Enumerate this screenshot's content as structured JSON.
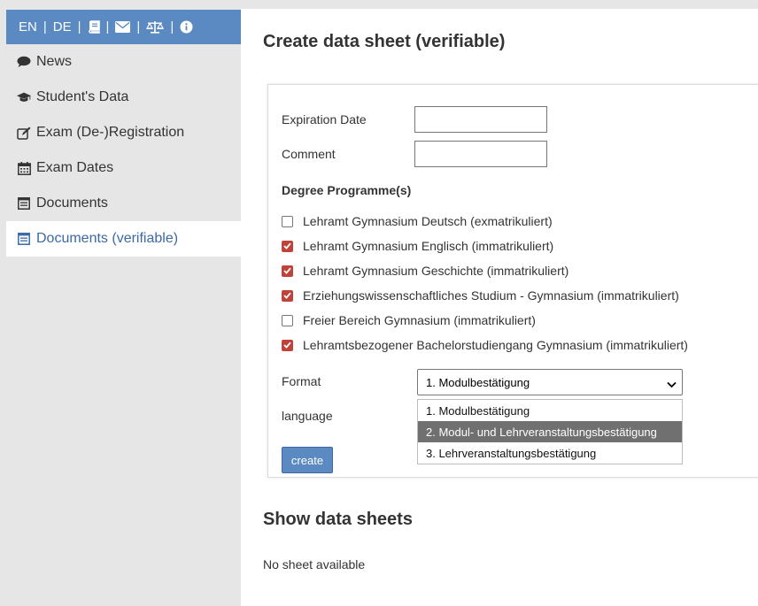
{
  "topbar": {
    "lang_en": "EN",
    "lang_de": "DE",
    "icons": [
      "book-icon",
      "envelope-icon",
      "scale-icon",
      "info-icon"
    ]
  },
  "sidebar": {
    "items": [
      {
        "label": "News",
        "icon": "comment-icon"
      },
      {
        "label": "Student's Data",
        "icon": "graduation-cap-icon"
      },
      {
        "label": "Exam (De-)Registration",
        "icon": "edit-icon"
      },
      {
        "label": "Exam Dates",
        "icon": "calendar-icon"
      },
      {
        "label": "Documents",
        "icon": "document-icon"
      },
      {
        "label": "Documents (verifiable)",
        "icon": "document-icon",
        "active": true
      }
    ]
  },
  "main": {
    "title": "Create data sheet (verifiable)",
    "form": {
      "expiration_label": "Expiration Date",
      "expiration_value": "",
      "comment_label": "Comment",
      "comment_value": "",
      "degree_heading": "Degree Programme(s)",
      "programmes": [
        {
          "label": "Lehramt Gymnasium Deutsch (exmatrikuliert)",
          "checked": false
        },
        {
          "label": "Lehramt Gymnasium Englisch (immatrikuliert)",
          "checked": true
        },
        {
          "label": "Lehramt Gymnasium Geschichte (immatrikuliert)",
          "checked": true
        },
        {
          "label": "Erziehungswissenschaftliches Studium - Gymnasium (immatrikuliert)",
          "checked": true
        },
        {
          "label": "Freier Bereich Gymnasium (immatrikuliert)",
          "checked": false
        },
        {
          "label": "Lehramtsbezogener Bachelorstudiengang Gymnasium (immatrikuliert)",
          "checked": true
        }
      ],
      "format_label": "Format",
      "format_selected": "1. Modulbestätigung",
      "format_options": [
        "1. Modulbestätigung",
        "2. Modul- und Lehrveranstaltungsbestätigung",
        "3. Lehrveranstaltungsbestätigung"
      ],
      "highlighted_option_index": 1,
      "language_label": "language",
      "create_label": "create"
    },
    "sheets_title": "Show data sheets",
    "no_sheet_text": "No sheet available"
  },
  "colors": {
    "sidebar_bg": "#e6e6e6",
    "accent": "#5b89c1",
    "active_text": "#3a69a6",
    "checkbox_on": "#c0433a"
  }
}
